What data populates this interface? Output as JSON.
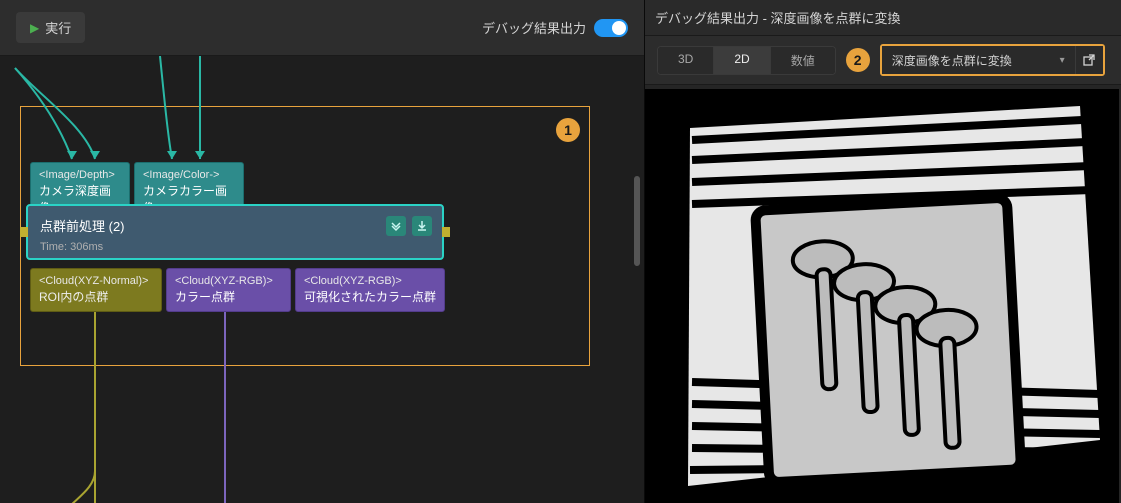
{
  "left": {
    "run_label": "実行",
    "debug_output_label": "デバッグ結果出力"
  },
  "graph": {
    "region1_marker": "1",
    "nodes": {
      "depth": {
        "tag": "<Image/Depth>",
        "label": "カメラ深度画像"
      },
      "color": {
        "tag": "<Image/Color->",
        "label": "カメラカラー画像"
      },
      "step": {
        "title": "点群前処理 (2)",
        "time": "Time: 306ms"
      },
      "out_roi": {
        "tag": "<Cloud(XYZ-Normal)>",
        "label": "ROI内の点群"
      },
      "out_rgb": {
        "tag": "<Cloud(XYZ-RGB)>",
        "label": "カラー点群"
      },
      "out_vis": {
        "tag": "<Cloud(XYZ-RGB)>",
        "label": "可視化されたカラー点群"
      }
    }
  },
  "right": {
    "header": "デバッグ結果出力 - 深度画像を点群に変換",
    "tabs": {
      "3d": "3D",
      "2d": "2D",
      "num": "数値"
    },
    "marker2": "2",
    "select_label": "深度画像を点群に変換"
  }
}
